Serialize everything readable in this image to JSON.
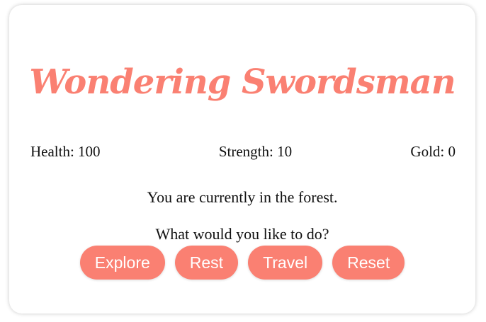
{
  "game": {
    "title": "Wondering Swordsman",
    "accent_color": "#fa8072"
  },
  "stats": {
    "health": "Health: 100",
    "strength": "Strength: 10",
    "gold": "Gold: 0"
  },
  "messages": {
    "location": "You are currently in the forest.",
    "prompt": "What would you like to do?"
  },
  "actions": {
    "explore": "Explore",
    "rest": "Rest",
    "travel": "Travel",
    "reset": "Reset"
  }
}
